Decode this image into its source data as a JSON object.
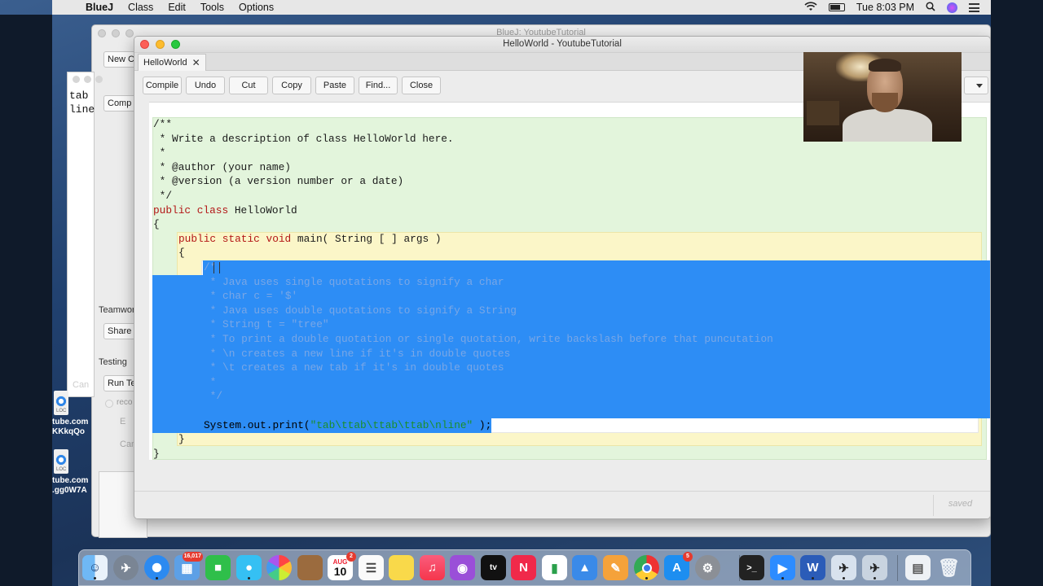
{
  "menubar": {
    "app_name": "BlueJ",
    "items": [
      "Class",
      "Edit",
      "Tools",
      "Options"
    ],
    "clock": "Tue 8:03 PM"
  },
  "project_window": {
    "title": "BlueJ: YoutubeTutorial",
    "new_class_label": "New Cl",
    "compile_label": "Comp",
    "teamwork_label": "Teamwork",
    "share_label": "Share",
    "testing_label": "Testing",
    "run_tests_label": "Run Te",
    "recording_label": "reco",
    "end_label": "E",
    "cancel_label": "Can",
    "ghost_cancel_label": "Can"
  },
  "terminal_strip": {
    "lines": [
      "tab",
      "line"
    ]
  },
  "desktop_files": [
    {
      "line1": "tube.com",
      "line2": "KKkqQo"
    },
    {
      "line1": "tube.com",
      "line2": ".gg0W7A"
    }
  ],
  "editor": {
    "window_title": "HelloWorld - YoutubeTutorial",
    "tab_label": "HelloWorld",
    "toolbar": {
      "compile": "Compile",
      "undo": "Undo",
      "cut": "Cut",
      "copy": "Copy",
      "paste": "Paste",
      "find": "Find...",
      "close": "Close"
    },
    "status": "saved",
    "code": {
      "l1": "/**",
      "l2": " * Write a description of class HelloWorld here.",
      "l3": " *",
      "l4": " * @author (your name)",
      "l5": " * @version (a version number or a date)",
      "l6": " */",
      "l7_kw": "public class",
      "l7_name": " HelloWorld",
      "l8": "{",
      "l9_kw": "public static void",
      "l9_rest": " main( String [ ] args )",
      "l10": "{",
      "l11": "/*",
      "l12": " * Java uses single quotations to signify a char",
      "l13": " * char c = '$'",
      "l14": " * Java uses double quotations to signify a String",
      "l15": " * String t = \"tree\"",
      "l16": " * To print a double quotation or single quotation, write backslash before that puncutation",
      "l17": " * \\n creates a new line if it's in double quotes",
      "l18": " * \\t creates a new tab if it's in double quotes",
      "l19": " *",
      "l20": " */",
      "l22_pre": "System.out.print(",
      "l22_str": "\"tab\\ttab\\ttab\\ttab\\nline\"",
      "l22_post": " );",
      "l23": "}",
      "l24": "}"
    }
  },
  "dock": {
    "calendar_month": "AUG",
    "calendar_day": "10",
    "badge_photos": "16,017",
    "badge_calendar": "2",
    "badge_appstore": "5",
    "apps": [
      "Finder",
      "Launchpad",
      "Safari",
      "FaceTime",
      "Messages",
      "Photos",
      "Notes Book",
      "Calendar",
      "Reminders",
      "Stickies",
      "Music",
      "Podcasts",
      "TV",
      "News",
      "Numbers",
      "Keynote",
      "Pages",
      "Chrome",
      "App Store",
      "System Preferences",
      "Terminal",
      "Zoom",
      "Word",
      "BlueJ",
      "BlueJ 2",
      "Downloads",
      "Trash"
    ]
  }
}
